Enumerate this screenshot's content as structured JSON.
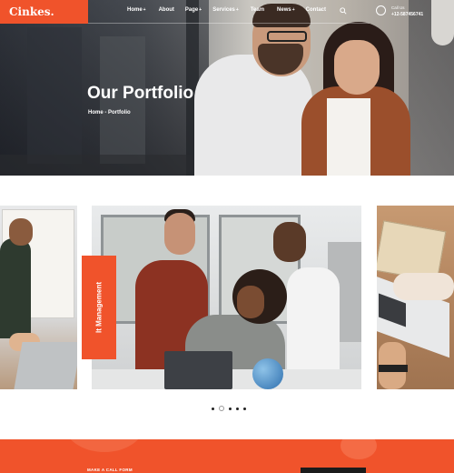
{
  "header": {
    "logo": "Cinkes.",
    "nav": [
      {
        "label": "Home",
        "dropdown": true
      },
      {
        "label": "About",
        "dropdown": false
      },
      {
        "label": "Page",
        "dropdown": true
      },
      {
        "label": "Services",
        "dropdown": true
      },
      {
        "label": "Team",
        "dropdown": false
      },
      {
        "label": "News",
        "dropdown": true
      },
      {
        "label": "Contact",
        "dropdown": false
      }
    ],
    "call_label": "Call Us",
    "call_number": "+12-587456741"
  },
  "hero": {
    "title": "Our Portfolio",
    "breadcrumb": "Home - Portfolio"
  },
  "portfolio": {
    "active_category": "It Management",
    "dots_count": 5,
    "active_dot": 1
  },
  "cta": {
    "label": "MAKE A CALL FORM"
  },
  "colors": {
    "accent": "#f0532b",
    "dark": "#1b1b1b"
  }
}
